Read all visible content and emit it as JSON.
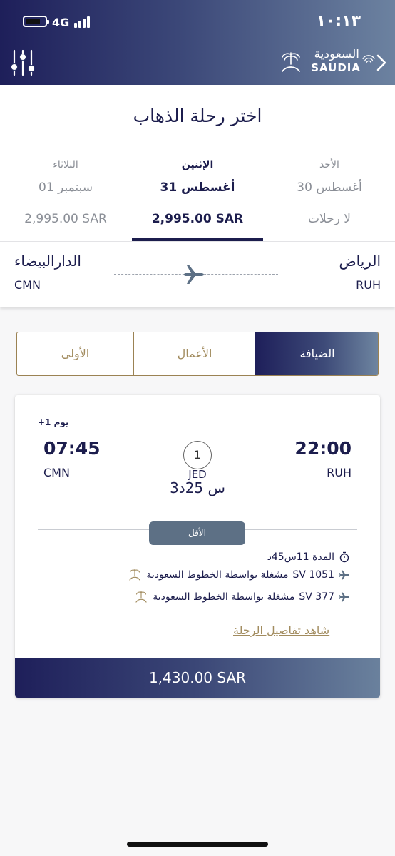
{
  "status_bar": {
    "network": "4G",
    "time": "١٠:١٣"
  },
  "header": {
    "logo_ar": "السعودية",
    "logo_en": "SAUDIA",
    "filter_icon": "sliders-icon",
    "back_icon": "chevron-right-icon"
  },
  "page": {
    "title": "اختر رحلة الذهاب"
  },
  "dates": [
    {
      "day": "الثلاثاء",
      "date": "01 سبتمبر",
      "price": "2,995.00 SAR",
      "selected": false
    },
    {
      "day": "الإثنين",
      "date": "31 أغسطس",
      "price": "2,995.00 SAR",
      "selected": true
    },
    {
      "day": "الأحد",
      "date": "30 أغسطس",
      "price": "لا رحلات",
      "selected": false
    }
  ],
  "route": {
    "origin_city": "الرياض",
    "origin_code": "RUH",
    "dest_city": "الدارالبيضاء",
    "dest_code": "CMN",
    "plane_icon": "airplane-icon"
  },
  "cabins": [
    {
      "label": "الأولى",
      "selected": false
    },
    {
      "label": "الأعمال",
      "selected": false
    },
    {
      "label": "الضيافة",
      "selected": true
    }
  ],
  "flight": {
    "plus_day": "+1 يوم",
    "arrival_time": "07:45",
    "arrival_code": "CMN",
    "departure_time": "22:00",
    "departure_code": "RUH",
    "stops": "1",
    "stop_code": "JED",
    "stop_duration": "3س 25د",
    "badge": "الأقل",
    "duration": "المدة 11س45د",
    "segments": [
      {
        "flight_no": "SV 1051",
        "operator": "مشغلة بواسطة الخطوط السعودية"
      },
      {
        "flight_no": "SV 377",
        "operator": "مشغلة بواسطة الخطوط السعودية"
      }
    ],
    "details_link": "شاهد تفاصيل الرحلة",
    "price": "1,430.00 SAR"
  },
  "colors": {
    "navy": "#1c1d4d",
    "gold": "#a28c5f",
    "gray": "#8a8e96",
    "badge": "#5d7085"
  }
}
